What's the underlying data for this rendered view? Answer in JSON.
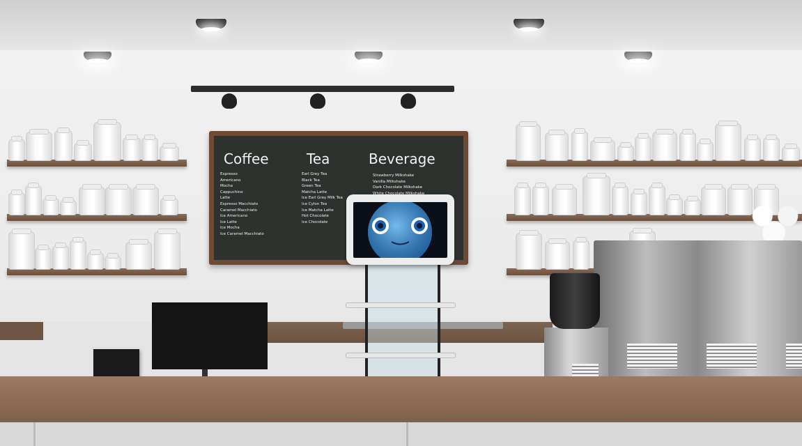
{
  "menu_board": {
    "columns": [
      {
        "title": "Coffee",
        "items": [
          "Expresso",
          "Americano",
          "Mocha",
          "Cappuchino",
          "Latte",
          "Espresso Macchiato",
          "Caramel Macchiato",
          "Ice Americano",
          "Ice Latte",
          "Ice Mocha",
          "Ice Caramel Macchiato"
        ]
      },
      {
        "title": "Tea",
        "items": [
          "Earl Grey Tea",
          "Black Tea",
          "Green Tea",
          "Matcha Latte",
          "Ice Earl Grey Milk Tea",
          "Ice Cylon Tea",
          "Ice Matcha Latte",
          "Hot Chocolate",
          "Ice Chocolate"
        ]
      },
      {
        "title": "Beverage",
        "items": [
          "Strawberry Milkshake",
          "Vanilla Milkshake",
          "Dark Chocolate Milkshake",
          "White Chocolate Milkshake"
        ]
      }
    ]
  },
  "colors": {
    "board_frame": "#6e4a33",
    "board_surface": "#2e322f",
    "counter_wood": "#8b6c56",
    "robot_face": "#4aa3e0"
  },
  "icons": [
    "robot-face-icon"
  ]
}
